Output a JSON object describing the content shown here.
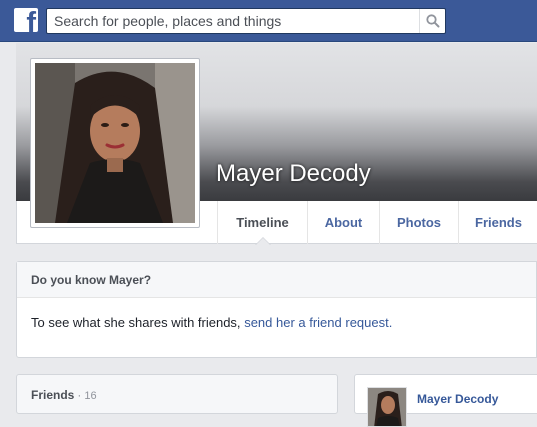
{
  "topbar": {
    "logo_letter": "f",
    "search_placeholder": "Search for people, places and things",
    "search_icon": "search-icon"
  },
  "profile": {
    "name": "Mayer Decody"
  },
  "tabs": [
    {
      "label": "Timeline",
      "active": true
    },
    {
      "label": "About",
      "active": false
    },
    {
      "label": "Photos",
      "active": false
    },
    {
      "label": "Friends",
      "active": false
    }
  ],
  "know_box": {
    "title": "Do you know Mayer?",
    "text": "To see what she shares with friends,",
    "link": "send her a friend request."
  },
  "friends_box": {
    "title": "Friends",
    "separator": "·",
    "count": "16"
  },
  "post": {
    "author": "Mayer Decody"
  },
  "colors": {
    "brand": "#3b5998",
    "link": "#365899",
    "background": "#e9eaed"
  }
}
